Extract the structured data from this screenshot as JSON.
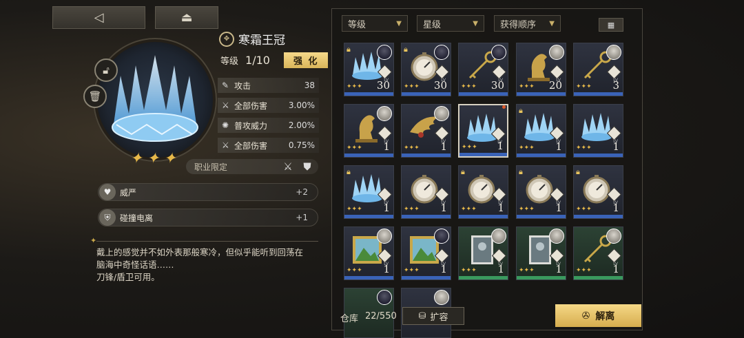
{
  "nav": {
    "back_icon": "◁",
    "home_icon": "⏏"
  },
  "item": {
    "name": "寒霜王冠",
    "level_label": "等级",
    "level_value": "1/10",
    "enhance_label": "强 化",
    "stats": [
      {
        "icon": "sword-icon",
        "glyph": "✎",
        "name": "攻击",
        "value": "38"
      },
      {
        "icon": "damage-icon",
        "glyph": "⚔",
        "name": "全部伤害",
        "value": "3.00%"
      },
      {
        "icon": "power-icon",
        "glyph": "✺",
        "name": "普攻威力",
        "value": "2.00%"
      },
      {
        "icon": "damage-icon",
        "glyph": "⚔",
        "name": "全部伤害",
        "value": "0.75%"
      }
    ],
    "job_restriction": "职业限定",
    "traits": [
      {
        "icon": "heart-icon",
        "glyph": "♥",
        "name": "威严",
        "value": "+2"
      },
      {
        "icon": "shield-icon",
        "glyph": "⛨",
        "name": "碰撞电离",
        "value": "+1"
      }
    ],
    "description": "戴上的感觉并不如外表那般寒冷，但似乎能听到回荡在\n脑海中奇怪话语……\n刀锋/盾卫可用。",
    "stars": "✦✦✦"
  },
  "filters": {
    "level": "等级",
    "star": "星级",
    "order": "获得顺序"
  },
  "inventory": {
    "items": [
      {
        "type": "crown",
        "count": "30",
        "locked": true,
        "avatar": "dark"
      },
      {
        "type": "compass",
        "count": "30",
        "locked": true,
        "avatar": "dark"
      },
      {
        "type": "key",
        "count": "30",
        "locked": false,
        "avatar": "dark"
      },
      {
        "type": "horse",
        "count": "20",
        "locked": false,
        "avatar": "light"
      },
      {
        "type": "key",
        "count": "3",
        "locked": false,
        "avatar": "light"
      },
      {
        "type": "horse",
        "count": "1",
        "locked": false,
        "avatar": "light"
      },
      {
        "type": "wing",
        "count": "1",
        "locked": false,
        "avatar": "light"
      },
      {
        "type": "crown",
        "count": "1",
        "locked": false,
        "avatar": "none",
        "selected": true
      },
      {
        "type": "crown",
        "count": "1",
        "locked": true,
        "avatar": "none"
      },
      {
        "type": "crown",
        "count": "1",
        "locked": false,
        "avatar": "none"
      },
      {
        "type": "crown",
        "count": "1",
        "locked": true,
        "avatar": "none"
      },
      {
        "type": "compass",
        "count": "1",
        "locked": false,
        "avatar": "none"
      },
      {
        "type": "compass",
        "count": "1",
        "locked": true,
        "avatar": "none"
      },
      {
        "type": "compass",
        "count": "1",
        "locked": true,
        "avatar": "none"
      },
      {
        "type": "compass",
        "count": "1",
        "locked": true,
        "avatar": "none"
      },
      {
        "type": "painting",
        "count": "1",
        "locked": false,
        "avatar": "light"
      },
      {
        "type": "painting",
        "count": "1",
        "locked": false,
        "avatar": "dark"
      },
      {
        "type": "portrait",
        "count": "1",
        "locked": false,
        "avatar": "light",
        "green": true
      },
      {
        "type": "portrait",
        "count": "1",
        "locked": false,
        "avatar": "light",
        "green": true
      },
      {
        "type": "key",
        "count": "1",
        "locked": false,
        "avatar": "light",
        "green": true
      },
      {
        "type": "partial",
        "count": "",
        "locked": false,
        "avatar": "dark",
        "green": true
      },
      {
        "type": "partial",
        "count": "",
        "locked": false,
        "avatar": "light"
      }
    ],
    "storage_label": "仓库",
    "storage_count": "22/550",
    "expand_label": "扩容",
    "dismantle_label": "解离"
  },
  "colors": {
    "accent_gold": "#e6b84a",
    "rarity_blue": "#3a63b8",
    "rarity_green": "#3a9a5e"
  }
}
